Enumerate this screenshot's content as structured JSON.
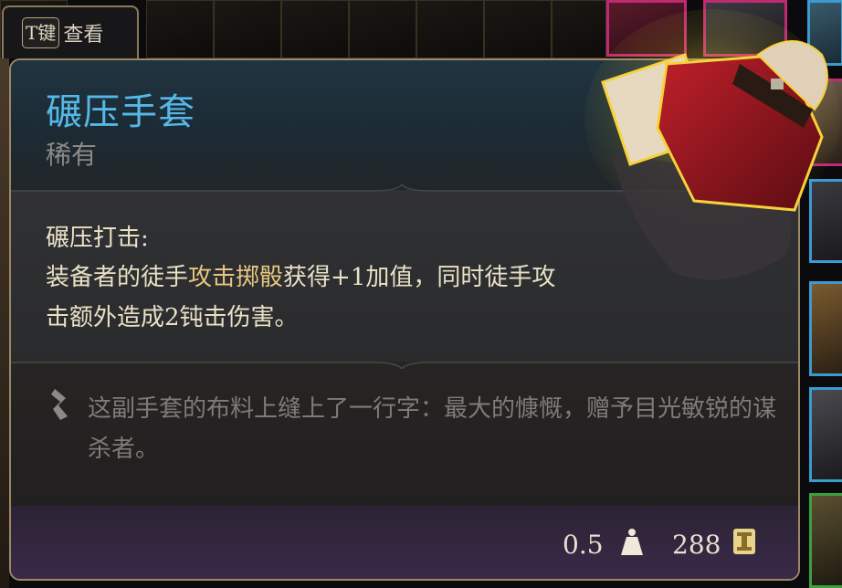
{
  "key_prompt": {
    "key": "T键",
    "action": "查看"
  },
  "item": {
    "name": "碾压手套",
    "rarity": "稀有",
    "ability_title": "碾压打击:",
    "description": {
      "part1": "装备者的徒手",
      "highlight": "攻击掷骰",
      "part2": "获得+1加值，同时徒手攻击额外造成2钝击伤害。"
    },
    "flavor_text": "这副手套的布料上缝上了一行字：最大的慷慨，赠予目光敏锐的谋杀者。",
    "weight": "0.5",
    "price": "288"
  },
  "colors": {
    "title": "#55b8e8",
    "border": "#9c8764",
    "highlight": "#e7c680",
    "glow": "#f6d23a"
  },
  "icons": [
    "flavor-quill-icon",
    "weight-icon",
    "gold-coin-icon",
    "glove-item-image"
  ]
}
